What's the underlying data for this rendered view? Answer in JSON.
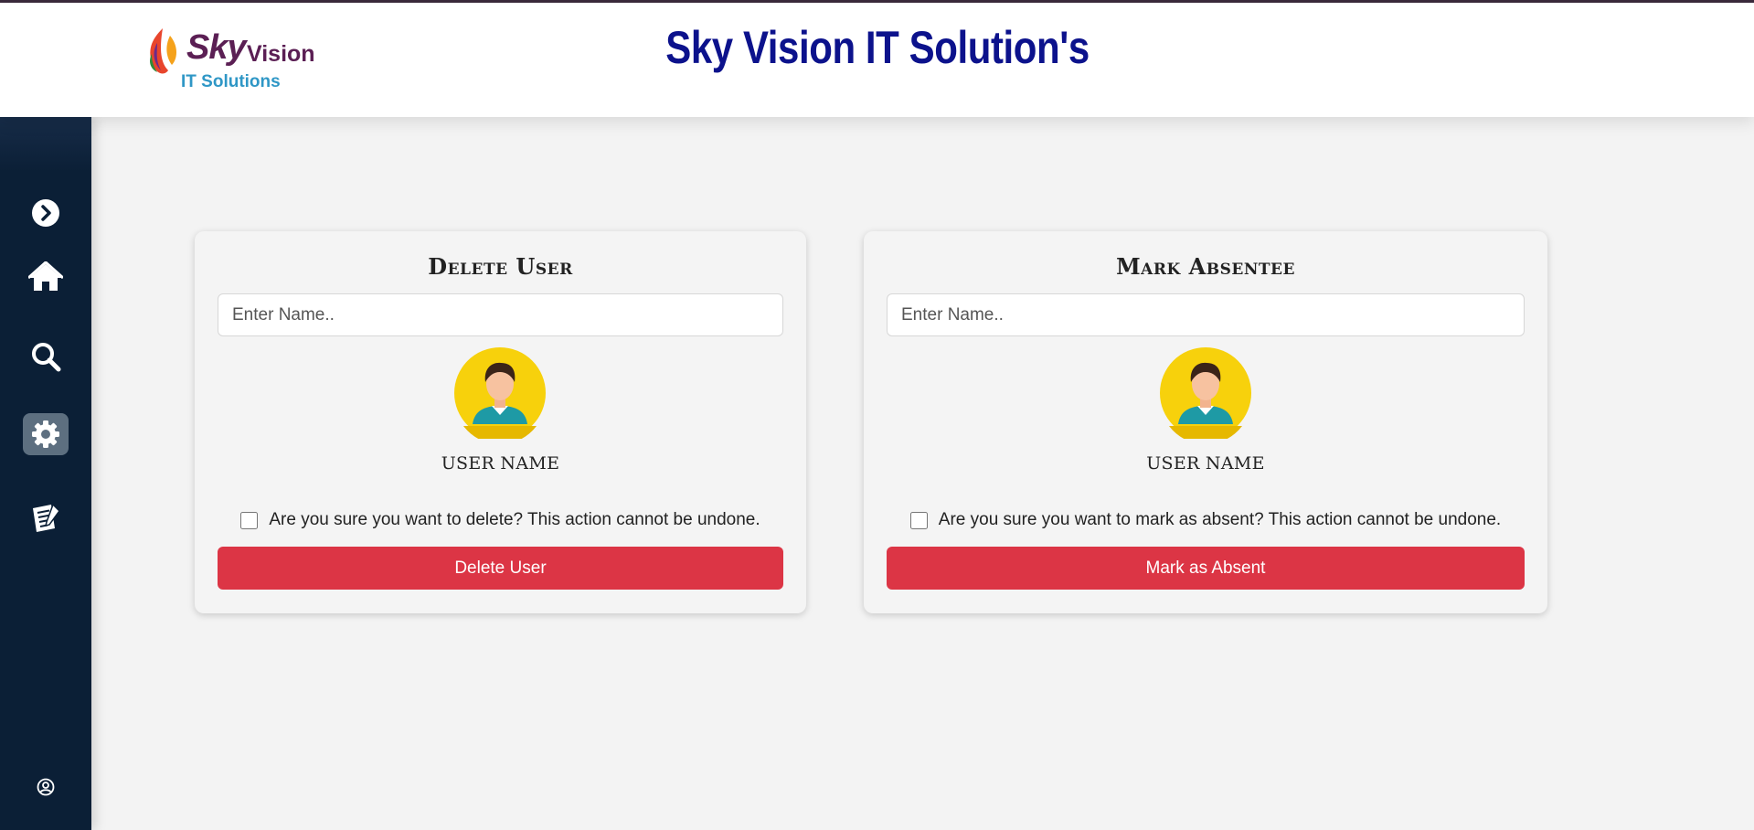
{
  "header": {
    "logo": {
      "word_main": "Sky",
      "word_small": "Vision",
      "subtitle": "IT Solutions"
    },
    "title": "Sky Vision IT Solution's"
  },
  "sidebar": {
    "items": [
      {
        "name": "expand",
        "icon": "chevron-right-circle-icon"
      },
      {
        "name": "home",
        "icon": "home-icon"
      },
      {
        "name": "search",
        "icon": "search-icon"
      },
      {
        "name": "settings",
        "icon": "gear-icon",
        "active": true
      },
      {
        "name": "reports",
        "icon": "notepad-icon"
      },
      {
        "name": "profile",
        "icon": "user-circle-icon"
      }
    ]
  },
  "delete_card": {
    "title": "Delete User",
    "name_input": {
      "placeholder": "Enter Name..",
      "value": ""
    },
    "user_name": "USER NAME",
    "confirm_text": "Are you sure you want to delete? This action cannot be undone.",
    "confirm_checked": false,
    "button_label": "Delete User"
  },
  "absent_card": {
    "title": "Mark Absentee",
    "name_input": {
      "placeholder": "Enter Name..",
      "value": ""
    },
    "user_name": "USER NAME",
    "confirm_text": "Are you sure you want to mark as absent? This action cannot be undone.",
    "confirm_checked": false,
    "button_label": "Mark as Absent"
  },
  "colors": {
    "header_title": "#0c128c",
    "sidebar_bg": "#0b1f36",
    "sidebar_active": "#5d6f80",
    "danger_button": "#dc3545",
    "avatar_bg": "#f7d10c",
    "logo_sub": "#2f97c6"
  }
}
